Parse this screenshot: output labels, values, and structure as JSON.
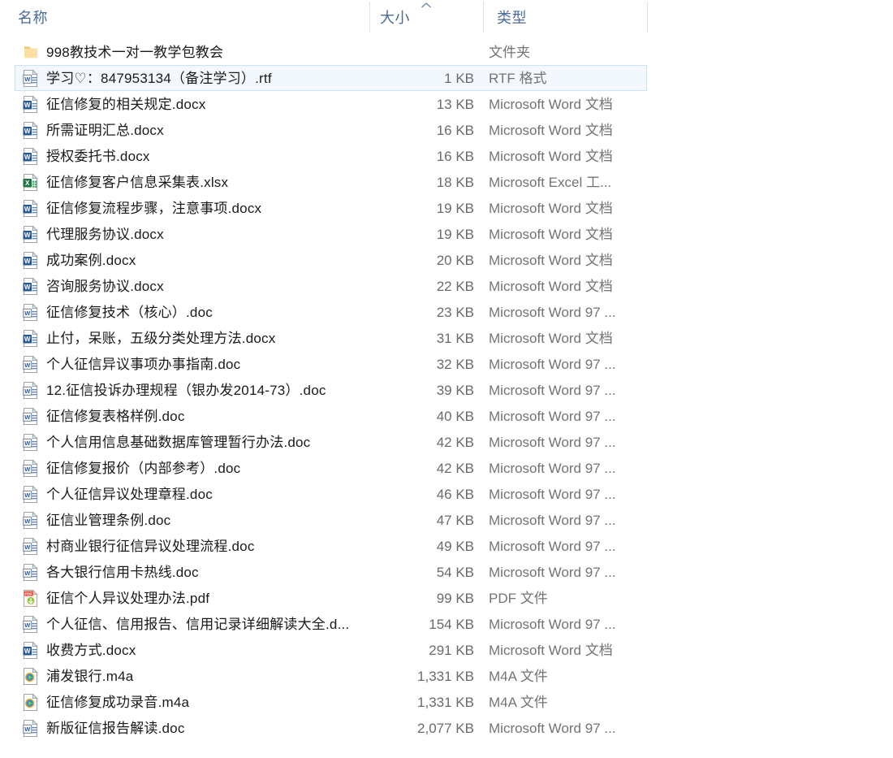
{
  "window": {
    "app": "file-explorer",
    "view_mode": "details"
  },
  "columns": {
    "name": {
      "label": "名称",
      "sort": "none"
    },
    "size": {
      "label": "大小",
      "sort": "ascending",
      "sort_icon": "caret-up-icon"
    },
    "type": {
      "label": "类型",
      "sort": "none"
    }
  },
  "colors": {
    "header_text": "#4a6b96",
    "selection_bg": "#f2f8fd",
    "selection_border": "#cce2f5",
    "name_text": "#1a1a1a",
    "meta_text": "#737373",
    "folder": "#f7d087",
    "word": "#2b579a",
    "excel": "#217346",
    "pdf": "#e8453c",
    "media": "#f5a623"
  },
  "files": [
    {
      "name": "998教技术一对一教学包教会",
      "size": "",
      "type": "文件夹",
      "icon": "folder-icon",
      "selected": false
    },
    {
      "name": "学习♡：847953134（备注学习）.rtf",
      "size": "1 KB",
      "type": "RTF 格式",
      "icon": "word-doc-icon",
      "selected": true
    },
    {
      "name": "征信修复的相关规定.docx",
      "size": "13 KB",
      "type": "Microsoft Word 文档",
      "icon": "word-docx-icon",
      "selected": false
    },
    {
      "name": "所需证明汇总.docx",
      "size": "16 KB",
      "type": "Microsoft Word 文档",
      "icon": "word-docx-icon",
      "selected": false
    },
    {
      "name": "授权委托书.docx",
      "size": "16 KB",
      "type": "Microsoft Word 文档",
      "icon": "word-docx-icon",
      "selected": false
    },
    {
      "name": "征信修复客户信息采集表.xlsx",
      "size": "18 KB",
      "type": "Microsoft Excel 工...",
      "icon": "excel-icon",
      "selected": false
    },
    {
      "name": "征信修复流程步骤，注意事项.docx",
      "size": "19 KB",
      "type": "Microsoft Word 文档",
      "icon": "word-docx-icon",
      "selected": false
    },
    {
      "name": "代理服务协议.docx",
      "size": "19 KB",
      "type": "Microsoft Word 文档",
      "icon": "word-docx-icon",
      "selected": false
    },
    {
      "name": "成功案例.docx",
      "size": "20 KB",
      "type": "Microsoft Word 文档",
      "icon": "word-docx-icon",
      "selected": false
    },
    {
      "name": "咨询服务协议.docx",
      "size": "22 KB",
      "type": "Microsoft Word 文档",
      "icon": "word-docx-icon",
      "selected": false
    },
    {
      "name": "征信修复技术（核心）.doc",
      "size": "23 KB",
      "type": "Microsoft Word 97 ...",
      "icon": "word-doc-icon",
      "selected": false
    },
    {
      "name": "止付，呆账，五级分类处理方法.docx",
      "size": "31 KB",
      "type": "Microsoft Word 文档",
      "icon": "word-docx-icon",
      "selected": false
    },
    {
      "name": "个人征信异议事项办事指南.doc",
      "size": "32 KB",
      "type": "Microsoft Word 97 ...",
      "icon": "word-doc-icon",
      "selected": false
    },
    {
      "name": "12.征信投诉办理规程（银办发2014-73）.doc",
      "size": "39 KB",
      "type": "Microsoft Word 97 ...",
      "icon": "word-doc-icon",
      "selected": false
    },
    {
      "name": "征信修复表格样例.doc",
      "size": "40 KB",
      "type": "Microsoft Word 97 ...",
      "icon": "word-doc-icon",
      "selected": false
    },
    {
      "name": "个人信用信息基础数据库管理暂行办法.doc",
      "size": "42 KB",
      "type": "Microsoft Word 97 ...",
      "icon": "word-doc-icon",
      "selected": false
    },
    {
      "name": "征信修复报价（内部参考）.doc",
      "size": "42 KB",
      "type": "Microsoft Word 97 ...",
      "icon": "word-doc-icon",
      "selected": false
    },
    {
      "name": "个人征信异议处理章程.doc",
      "size": "46 KB",
      "type": "Microsoft Word 97 ...",
      "icon": "word-doc-icon",
      "selected": false
    },
    {
      "name": "征信业管理条例.doc",
      "size": "47 KB",
      "type": "Microsoft Word 97 ...",
      "icon": "word-doc-icon",
      "selected": false
    },
    {
      "name": "村商业银行征信异议处理流程.doc",
      "size": "49 KB",
      "type": "Microsoft Word 97 ...",
      "icon": "word-doc-icon",
      "selected": false
    },
    {
      "name": "各大银行信用卡热线.doc",
      "size": "54 KB",
      "type": "Microsoft Word 97 ...",
      "icon": "word-doc-icon",
      "selected": false
    },
    {
      "name": "征信个人异议处理办法.pdf",
      "size": "99 KB",
      "type": "PDF 文件",
      "icon": "pdf-icon",
      "selected": false
    },
    {
      "name": "个人征信、信用报告、信用记录详细解读大全.d...",
      "size": "154 KB",
      "type": "Microsoft Word 97 ...",
      "icon": "word-doc-icon",
      "selected": false
    },
    {
      "name": "收费方式.docx",
      "size": "291 KB",
      "type": "Microsoft Word 文档",
      "icon": "word-docx-icon",
      "selected": false
    },
    {
      "name": "浦发银行.m4a",
      "size": "1,331 KB",
      "type": "M4A 文件",
      "icon": "media-icon",
      "selected": false
    },
    {
      "name": "征信修复成功录音.m4a",
      "size": "1,331 KB",
      "type": "M4A 文件",
      "icon": "media-icon",
      "selected": false
    },
    {
      "name": "新版征信报告解读.doc",
      "size": "2,077 KB",
      "type": "Microsoft Word 97 ...",
      "icon": "word-doc-icon",
      "selected": false
    }
  ]
}
